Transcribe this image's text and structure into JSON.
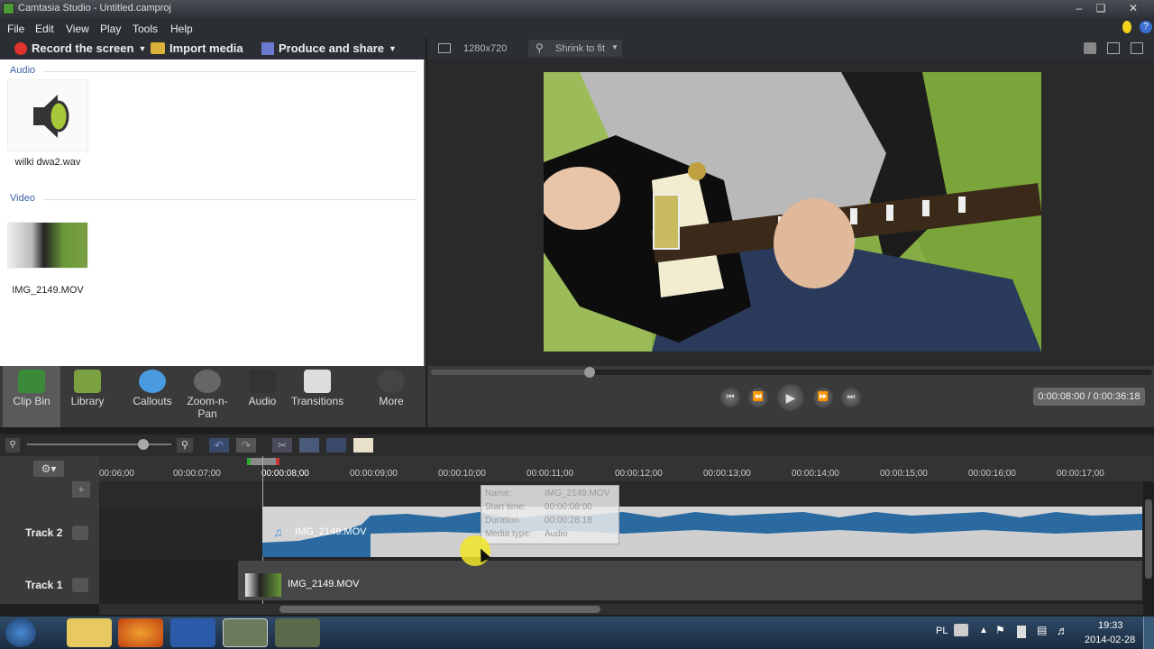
{
  "window": {
    "title": "Camtasia Studio - Untitled.camproj"
  },
  "menu": [
    "File",
    "Edit",
    "View",
    "Play",
    "Tools",
    "Help"
  ],
  "toolbar": {
    "record": "Record the screen",
    "import": "Import media",
    "produce": "Produce and share"
  },
  "clipbin": {
    "audio_section": "Audio",
    "video_section": "Video",
    "audio_file": "wilki dwa2.wav",
    "video_file": "IMG_2149.MOV"
  },
  "preview": {
    "dimensions": "1280x720",
    "zoom": "Shrink to fit"
  },
  "transport": {
    "time": "0:00:08:00 / 0:00:36:18",
    "progress": 0.22
  },
  "tabs": [
    "Clip Bin",
    "Library",
    "Callouts",
    "Zoom-n-Pan",
    "Audio",
    "Transitions",
    "More"
  ],
  "ruler": [
    "00:06;00",
    "00:00:07;00",
    "00:00:08;00",
    "00:00:09;00",
    "00:00:10;00",
    "00:00:11;00",
    "00:00:12;00",
    "00:00:13;00",
    "00:00:14;00",
    "00:00:15;00",
    "00:00:16;00",
    "00:00:17;00"
  ],
  "tracks": {
    "track2": "Track 2",
    "track1": "Track 1",
    "audio_clip": "IMG_2149.MOV",
    "video_clip": "IMG_2149.MOV"
  },
  "tooltip": {
    "name_label": "Name:",
    "name_value": "IMG_2149.MOV",
    "start_label": "Start time:",
    "start_value": "00:00:08:00",
    "duration_label": "Duration:",
    "duration_value": "00:00:28:18",
    "type_label": "Media type:",
    "type_value": "Audio"
  },
  "taskbar": {
    "lang": "PL",
    "time": "19:33",
    "date": "2014-02-28"
  }
}
